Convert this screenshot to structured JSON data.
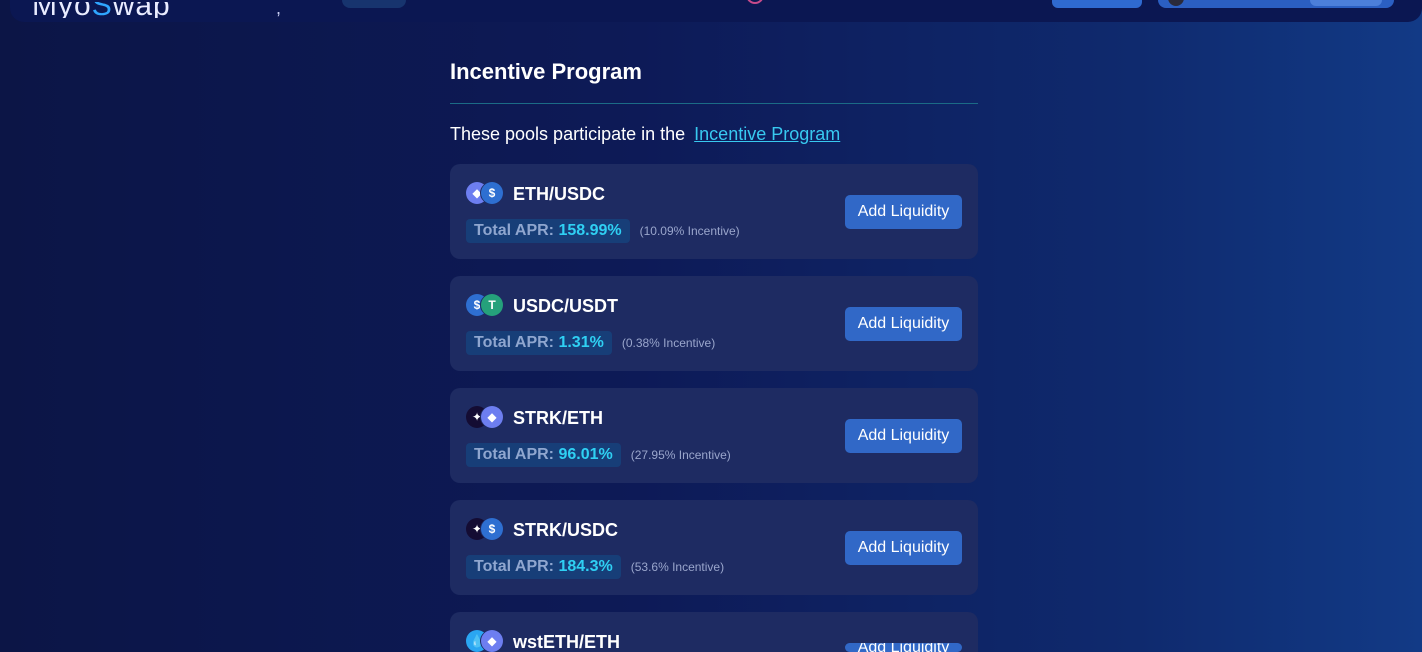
{
  "header": {
    "logo_text_1": "Myo",
    "logo_text_accent": "S",
    "logo_text_2": "wap",
    "comma": ","
  },
  "section": {
    "title": "Incentive Program",
    "intro_text": "These pools participate in the",
    "intro_link": "Incentive Program"
  },
  "pools": [
    {
      "name": "ETH/USDC",
      "token_a_icon": "eth-icon",
      "token_b_icon": "usdc-icon",
      "apr_label": "Total APR:",
      "apr_value": "158.99%",
      "incentive": "(10.09% Incentive)",
      "button": "Add Liquidity"
    },
    {
      "name": "USDC/USDT",
      "token_a_icon": "usdc-icon",
      "token_b_icon": "usdt-icon",
      "apr_label": "Total APR:",
      "apr_value": "1.31%",
      "incentive": "(0.38% Incentive)",
      "button": "Add Liquidity"
    },
    {
      "name": "STRK/ETH",
      "token_a_icon": "strk-icon",
      "token_b_icon": "eth-icon",
      "apr_label": "Total APR:",
      "apr_value": "96.01%",
      "incentive": "(27.95% Incentive)",
      "button": "Add Liquidity"
    },
    {
      "name": "STRK/USDC",
      "token_a_icon": "strk-icon",
      "token_b_icon": "usdc-icon",
      "apr_label": "Total APR:",
      "apr_value": "184.3%",
      "incentive": "(53.6% Incentive)",
      "button": "Add Liquidity"
    },
    {
      "name": "wstETH/ETH",
      "token_a_icon": "wsteth-icon",
      "token_b_icon": "eth-icon",
      "button": "Add Liquidity"
    }
  ],
  "colors": {
    "background": "#0d1a57",
    "card": "#1e2b62",
    "accent": "#2fd0f3",
    "link": "#38c9f0",
    "button": "#3168c7"
  }
}
